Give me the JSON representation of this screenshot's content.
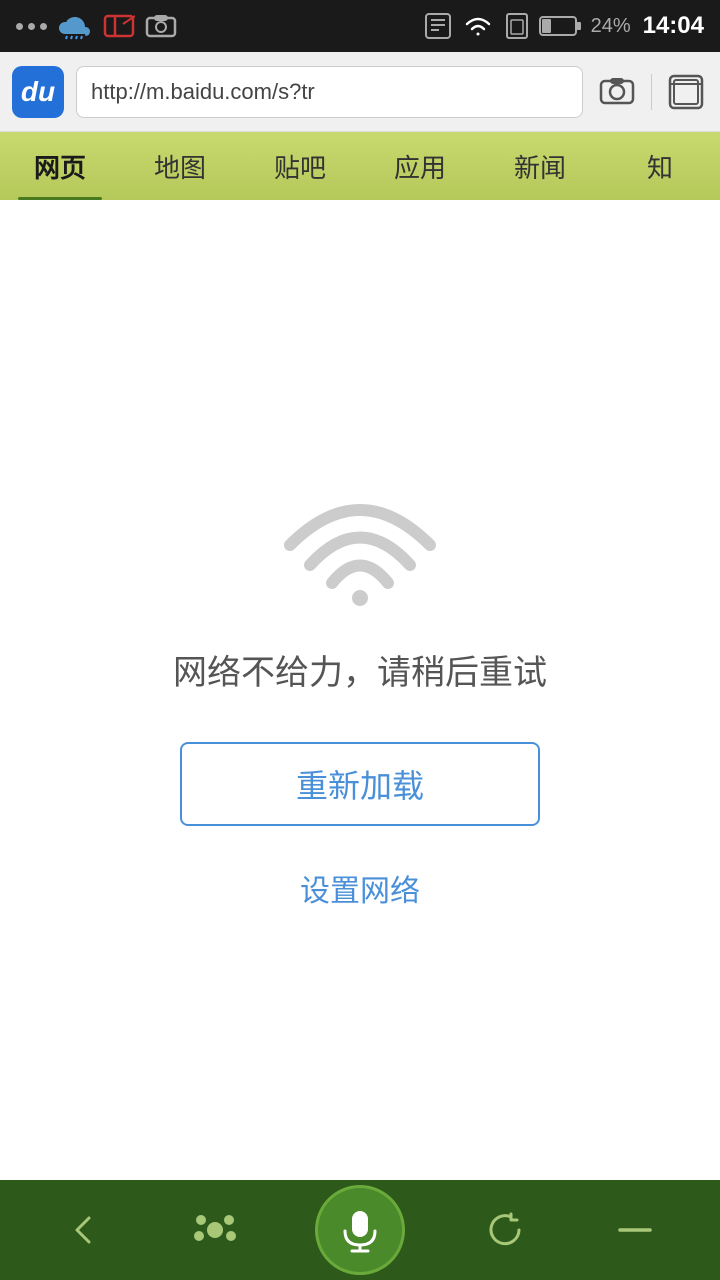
{
  "statusBar": {
    "time": "14:04",
    "battery": "24%"
  },
  "addressBar": {
    "logoText": "du",
    "url": "http://m.baidu.com/s?tr",
    "cameraIconLabel": "camera-icon",
    "tabIconLabel": "tab-icon"
  },
  "navTabs": [
    {
      "label": "网页",
      "active": true
    },
    {
      "label": "地图",
      "active": false
    },
    {
      "label": "贴吧",
      "active": false
    },
    {
      "label": "应用",
      "active": false
    },
    {
      "label": "新闻",
      "active": false
    },
    {
      "label": "知",
      "active": false
    }
  ],
  "errorPage": {
    "message": "网络不给力，请稍后重试",
    "reloadLabel": "重新加载",
    "settingsLabel": "设置网络"
  },
  "bottomBar": {
    "backLabel": "‹",
    "homeLabel": "⠿",
    "micLabel": "🎤",
    "refreshLabel": "↻",
    "menuLabel": "—"
  }
}
